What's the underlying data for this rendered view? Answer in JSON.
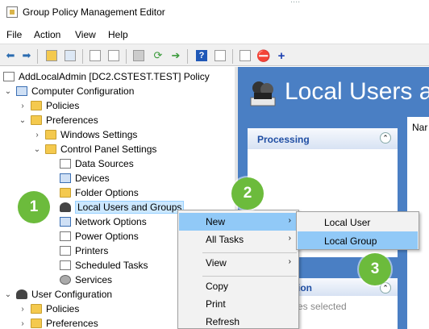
{
  "window": {
    "title": "Group Policy Management Editor",
    "background_text": "...."
  },
  "menu": [
    "File",
    "Action",
    "View",
    "Help"
  ],
  "toolbar_icons": [
    "back-arrow",
    "forward-arrow",
    "up-folder",
    "show-hide-tree",
    "copy",
    "paste",
    "print",
    "refresh",
    "export",
    "help",
    "properties",
    "new-item",
    "stop",
    "add"
  ],
  "tree": {
    "root": "AddLocalAdmin [DC2.CSTEST.TEST] Policy",
    "computer_configuration": "Computer Configuration",
    "policies": "Policies",
    "preferences": "Preferences",
    "windows_settings": "Windows Settings",
    "control_panel_settings": "Control Panel Settings",
    "cp_items": [
      "Data Sources",
      "Devices",
      "Folder Options",
      "Local Users and Groups",
      "Network Options",
      "Power Options",
      "Printers",
      "Scheduled Tasks",
      "Services"
    ],
    "user_configuration": "User Configuration",
    "user_policies": "Policies",
    "user_preferences": "Preferences"
  },
  "right_pane": {
    "title": "Local Users a",
    "processing_header": "Processing",
    "description_header": "ion",
    "description_body": "es selected",
    "list_column": "Nar"
  },
  "context_menu": {
    "items": [
      {
        "label": "New",
        "submenu": true
      },
      {
        "label": "All Tasks",
        "submenu": true
      },
      {
        "label": "View",
        "submenu": true
      },
      {
        "label": "Copy",
        "submenu": false
      },
      {
        "label": "Print",
        "submenu": false
      },
      {
        "label": "Refresh",
        "submenu": false
      }
    ]
  },
  "submenu": {
    "items": [
      "Local User",
      "Local Group"
    ],
    "highlighted": "Local Group"
  },
  "callouts": [
    "1",
    "2",
    "3"
  ],
  "colors": {
    "callout_green": "#6cbb3c",
    "menu_highlight": "#91c9f7",
    "right_pane_blue": "#4a7fc4"
  }
}
